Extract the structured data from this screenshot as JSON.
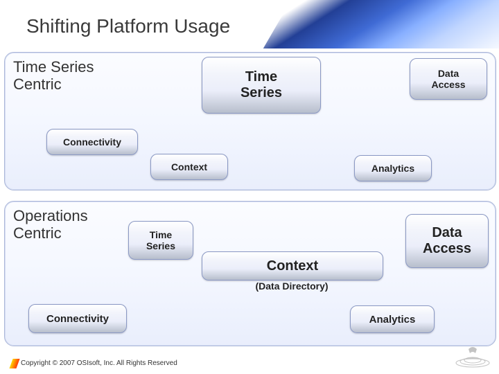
{
  "title": "Shifting Platform Usage",
  "panels": {
    "top": {
      "title": "Time Series\nCentric",
      "boxes": {
        "time_series": "Time\nSeries",
        "data_access": "Data\nAccess",
        "connectivity": "Connectivity",
        "context": "Context",
        "analytics": "Analytics"
      }
    },
    "bottom": {
      "title": "Operations\nCentric",
      "boxes": {
        "time_series": "Time\nSeries",
        "data_access": "Data\nAccess",
        "context": "Context",
        "context_sub": "(Data Directory)",
        "connectivity": "Connectivity",
        "analytics": "Analytics"
      }
    }
  },
  "footer": {
    "copyright": "Copyright © 2007 OSIsoft, Inc. All Rights Reserved"
  }
}
